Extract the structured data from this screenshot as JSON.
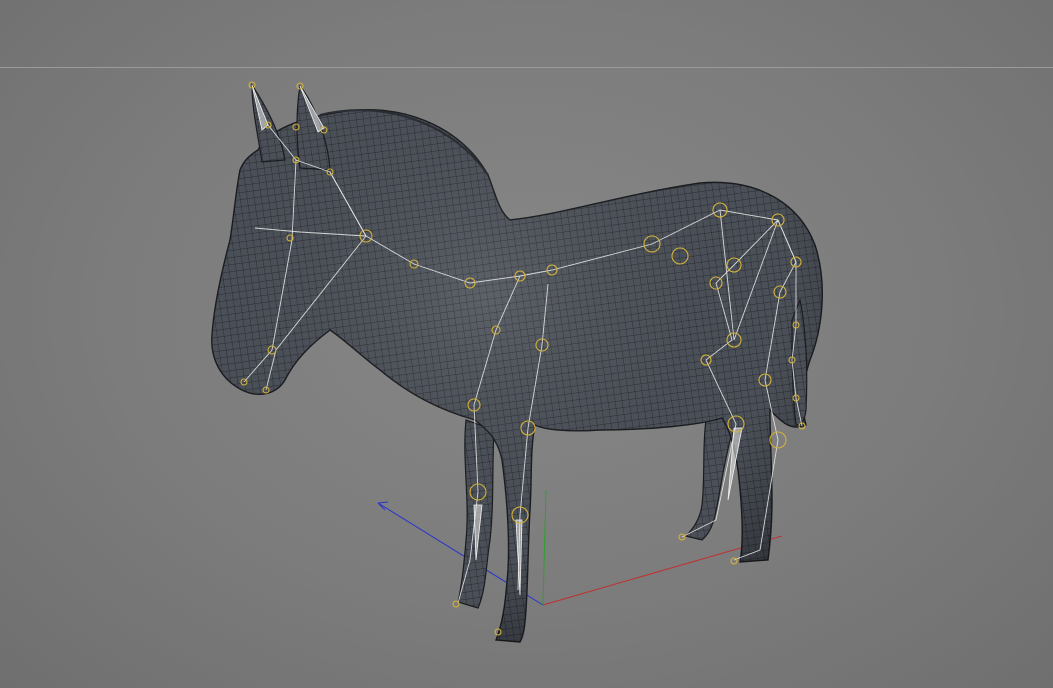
{
  "viewport": {
    "background": "#7c7c7c",
    "horizon_color": "#9a9a9a"
  },
  "model": {
    "subject": "zebra-mesh",
    "mesh_color": "#454a52",
    "wire_color": "#1c1e22"
  },
  "rig": {
    "bone_color": "#e6e6e6",
    "joint_color": "#d4b33a"
  },
  "axes": {
    "x_color": "#c0302e",
    "y_color": "#2ea030",
    "z_color": "#2a35c8"
  }
}
